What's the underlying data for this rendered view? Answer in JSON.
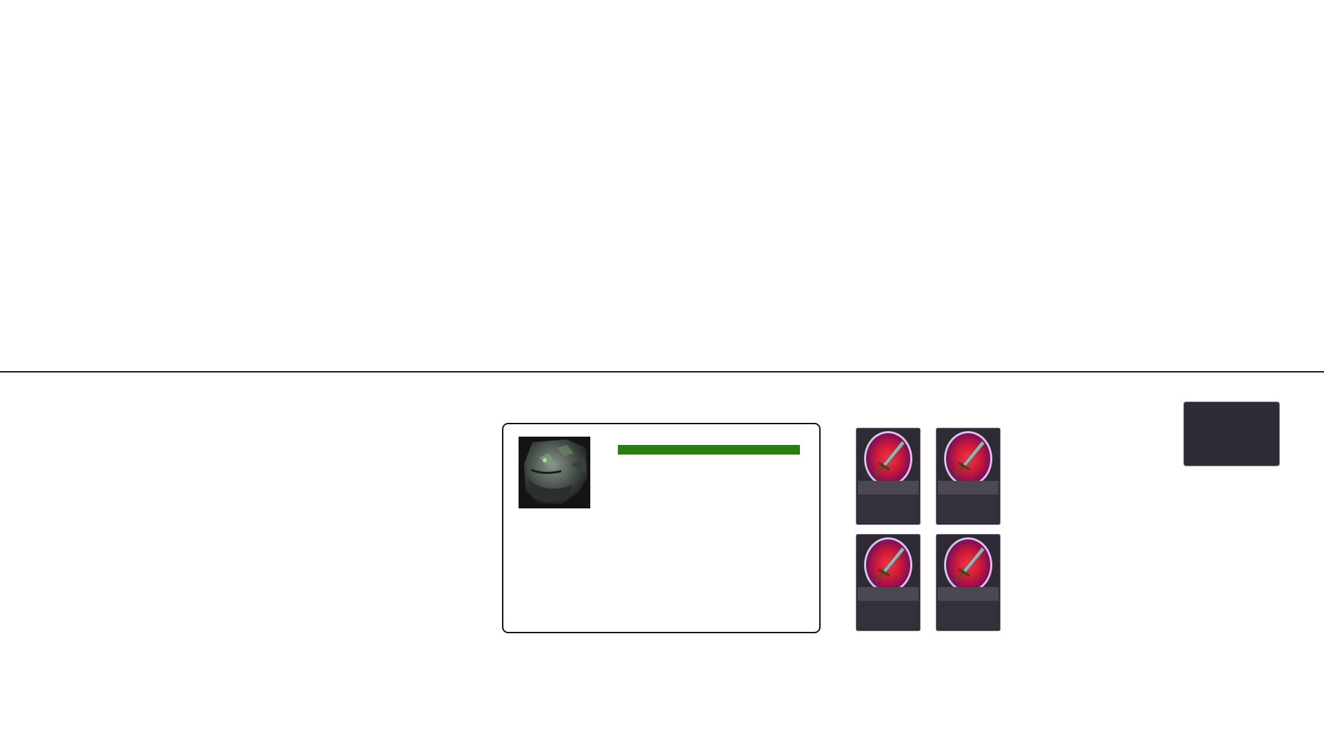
{
  "game": {
    "selected_unit": {
      "portrait_icon": "dragon-head-portrait",
      "health_fraction": 1.0,
      "health_color": "#2a7e0f"
    },
    "abilities": [
      {
        "icon": "sword-attack-icon"
      },
      {
        "icon": "sword-attack-icon"
      },
      {
        "icon": "sword-attack-icon"
      },
      {
        "icon": "sword-attack-icon"
      }
    ],
    "menu_button": {
      "label": ""
    }
  }
}
